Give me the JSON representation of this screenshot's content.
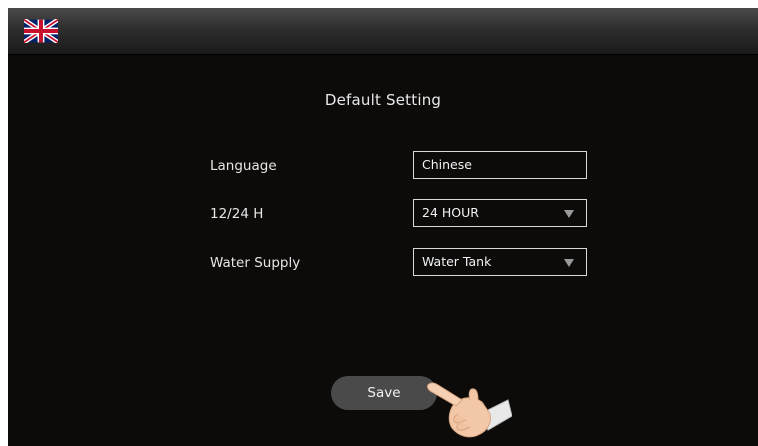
{
  "header": {
    "language_flag": "uk-flag-icon"
  },
  "page": {
    "title": "Default Setting"
  },
  "settings": {
    "language": {
      "label": "Language",
      "value": "Chinese"
    },
    "time_format": {
      "label": "12/24 H",
      "value": "24 HOUR"
    },
    "water_supply": {
      "label": "Water Supply",
      "value": "Water Tank"
    }
  },
  "actions": {
    "save_label": "Save"
  },
  "decor": {
    "pointer_hand": "pointing-hand-icon"
  },
  "colors": {
    "background": "#0d0b0a",
    "top_bar": "#2e2e2e",
    "button": "#4a4a4a",
    "text": "#e6e6e6"
  }
}
